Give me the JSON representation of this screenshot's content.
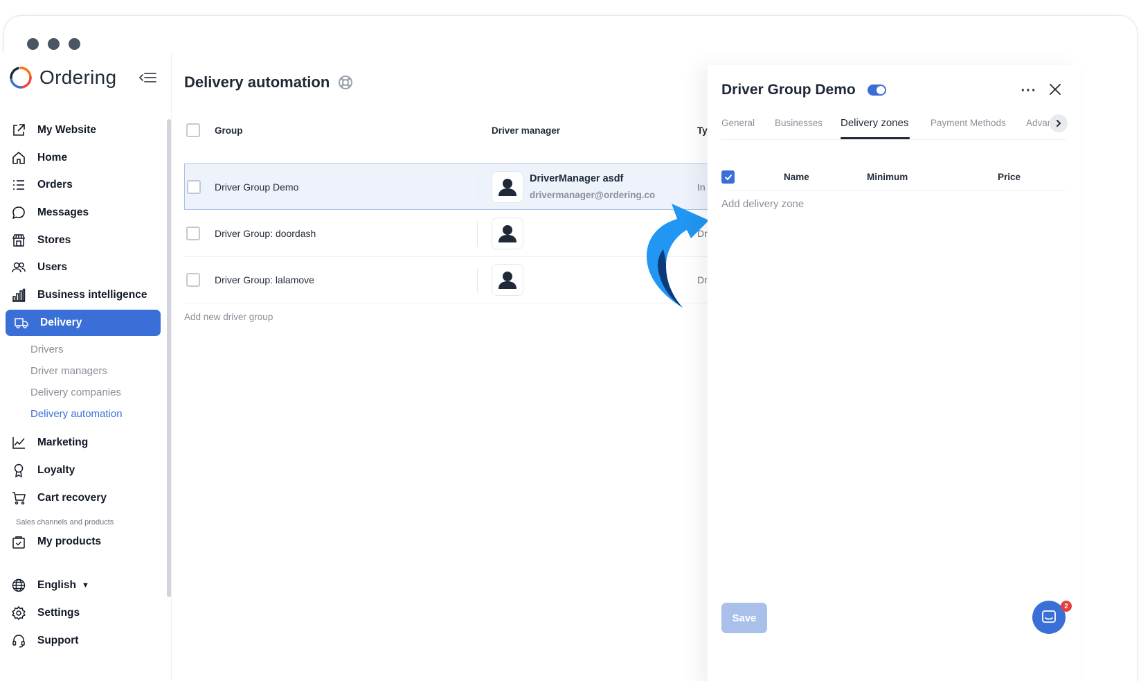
{
  "app": {
    "logo_text": "Ordering"
  },
  "sidebar": {
    "items": [
      {
        "label": "My Website",
        "icon": "external-link-icon"
      },
      {
        "label": "Home",
        "icon": "home-icon"
      },
      {
        "label": "Orders",
        "icon": "list-icon"
      },
      {
        "label": "Messages",
        "icon": "chat-bubble-icon"
      },
      {
        "label": "Stores",
        "icon": "store-icon"
      },
      {
        "label": "Users",
        "icon": "users-icon"
      },
      {
        "label": "Business intelligence",
        "icon": "bar-chart-icon"
      },
      {
        "label": "Delivery",
        "icon": "truck-icon",
        "active": true
      },
      {
        "label": "Marketing",
        "icon": "line-chart-icon"
      },
      {
        "label": "Loyalty",
        "icon": "award-icon"
      },
      {
        "label": "Cart recovery",
        "icon": "cart-icon"
      },
      {
        "label": "My products",
        "icon": "bag-check-icon"
      },
      {
        "label": "English",
        "icon": "globe-icon"
      },
      {
        "label": "Settings",
        "icon": "gear-icon"
      },
      {
        "label": "Support",
        "icon": "headset-icon"
      }
    ],
    "delivery_sub": [
      "Drivers",
      "Driver managers",
      "Delivery companies",
      "Delivery automation"
    ],
    "section_label": "Sales channels and products"
  },
  "main": {
    "title": "Delivery automation",
    "columns": {
      "group": "Group",
      "driver_manager": "Driver manager",
      "type": "Typ"
    },
    "rows": [
      {
        "group": "Driver Group Demo",
        "manager_name": "DriverManager asdf",
        "manager_email": "drivermanager@ordering.co",
        "type": "In h"
      },
      {
        "group": "Driver Group: doordash",
        "manager_name": "",
        "manager_email": "",
        "type": "Driv"
      },
      {
        "group": "Driver Group: lalamove",
        "manager_name": "",
        "manager_email": "",
        "type": "Driv"
      }
    ],
    "add_group": "Add new driver group"
  },
  "panel": {
    "title": "Driver Group Demo",
    "toggle_on": true,
    "tabs": [
      "General",
      "Businesses",
      "Delivery zones",
      "Payment Methods",
      "Advan"
    ],
    "active_tab": "Delivery zones",
    "zone_columns": {
      "name": "Name",
      "minimum": "Minimum",
      "price": "Price"
    },
    "add_zone": "Add delivery zone",
    "save_label": "Save",
    "chat_badge": "2"
  },
  "colors": {
    "accent": "#3b6fd8",
    "arrow": "#2196f3",
    "arrow_dark": "#0d3a78"
  }
}
